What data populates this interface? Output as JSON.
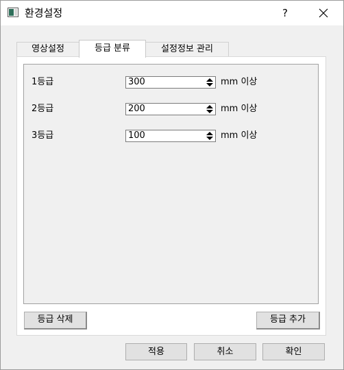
{
  "window": {
    "title": "환경설정",
    "help": "?"
  },
  "tabs": [
    {
      "label": "영상설정",
      "active": false
    },
    {
      "label": "등급 분류",
      "active": true
    },
    {
      "label": "설정정보 관리",
      "active": false
    }
  ],
  "grades": [
    {
      "label": "1등급",
      "value": "300",
      "unit": "mm 이상"
    },
    {
      "label": "2등급",
      "value": "200",
      "unit": "mm 이상"
    },
    {
      "label": "3등급",
      "value": "100",
      "unit": "mm 이상"
    }
  ],
  "buttons": {
    "delete_grade": "등급 삭제",
    "add_grade": "등급 추가",
    "apply": "적용",
    "cancel": "취소",
    "ok": "확인"
  },
  "icons": {
    "app": "window-app-icon",
    "close": "close-icon",
    "spin": "spin-arrows-icon"
  }
}
